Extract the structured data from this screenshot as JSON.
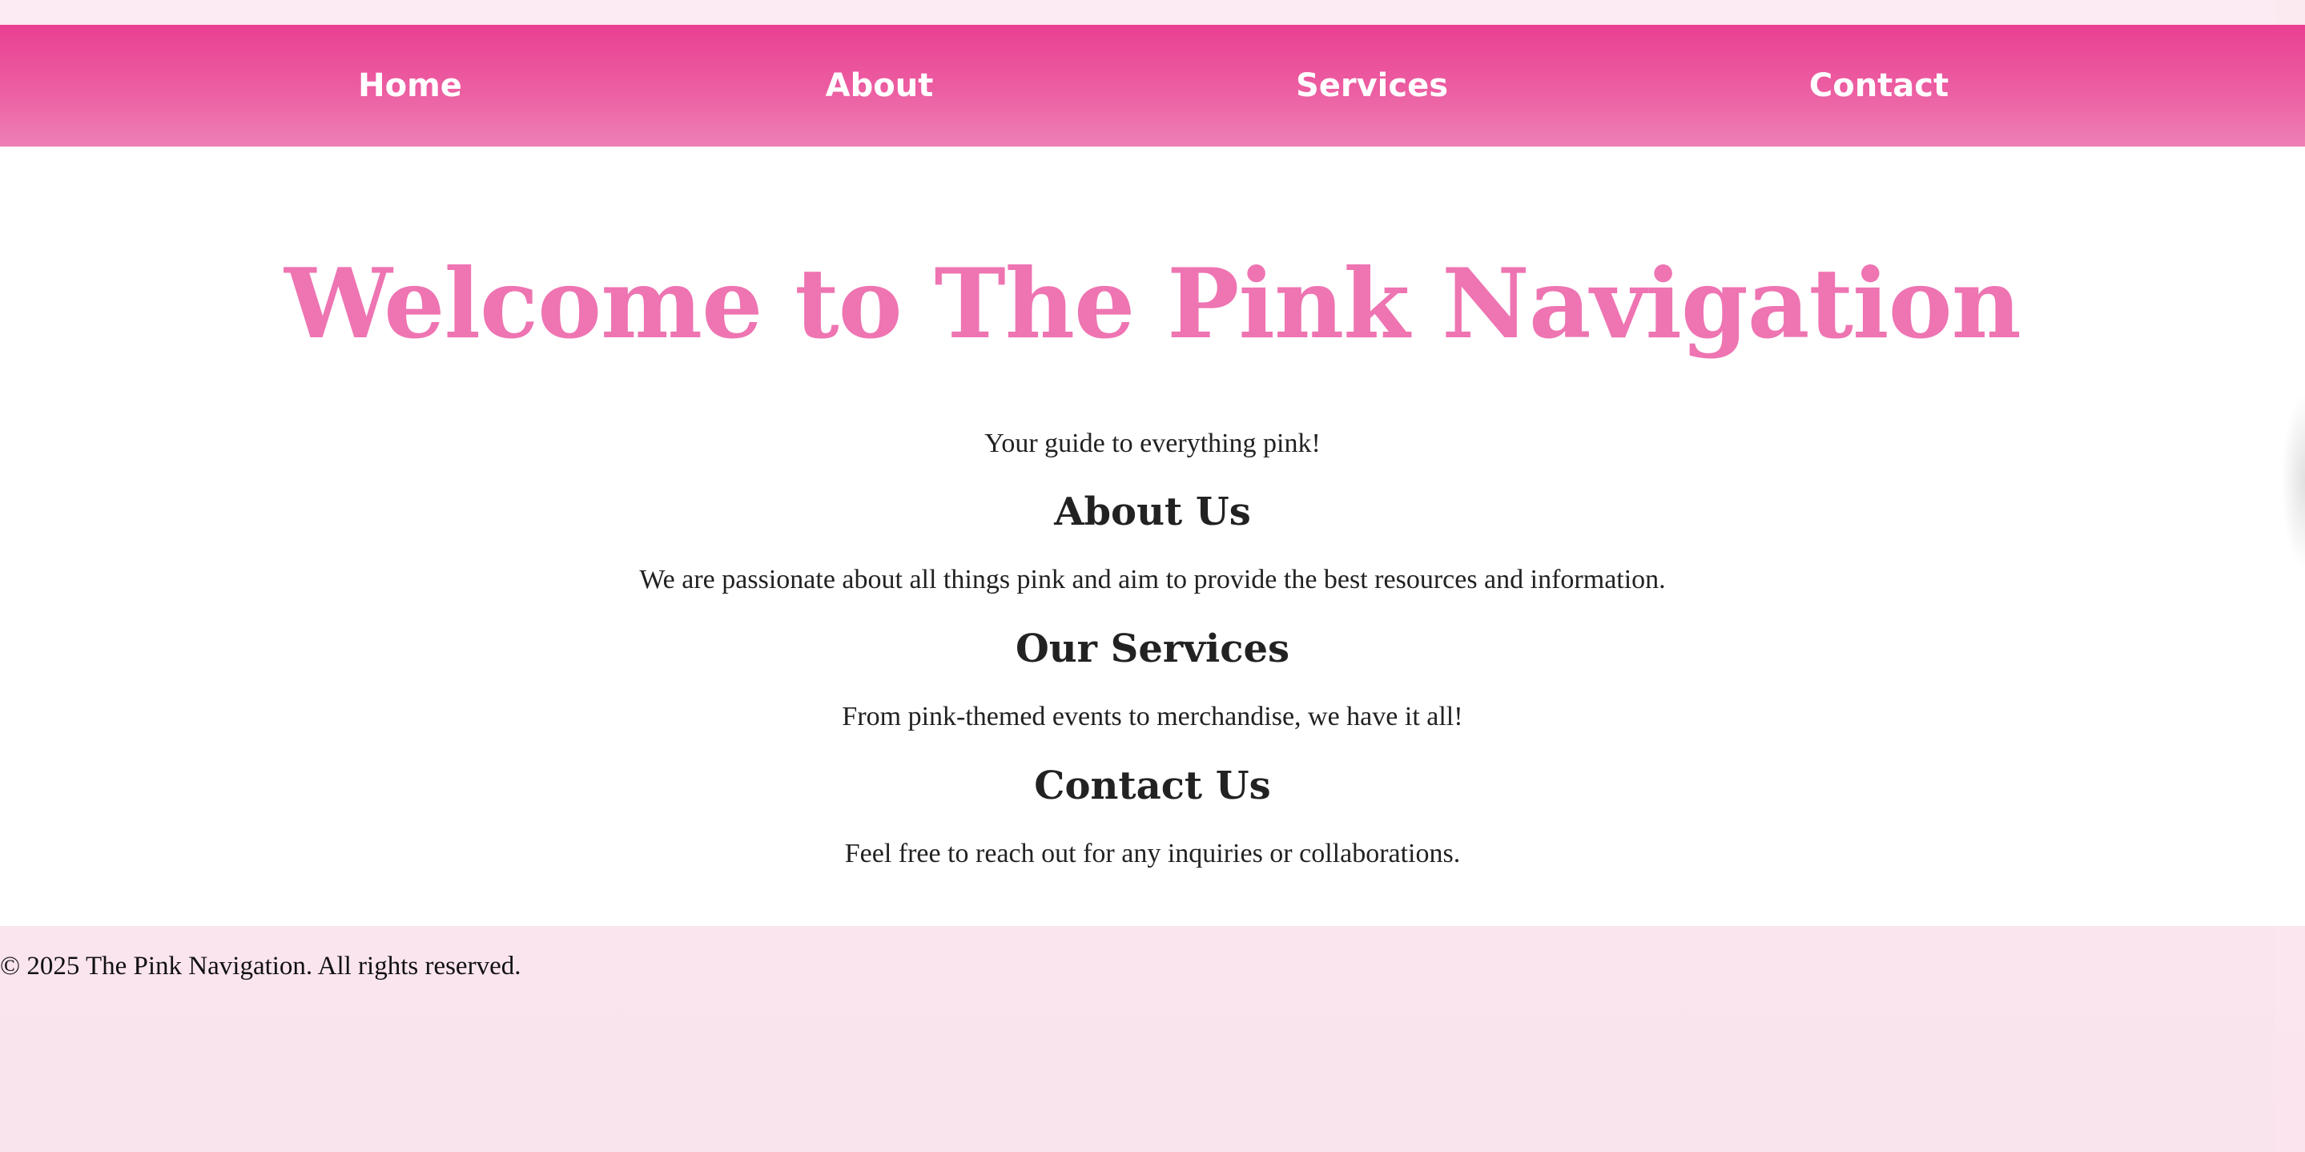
{
  "nav": {
    "items": [
      {
        "label": "Home"
      },
      {
        "label": "About"
      },
      {
        "label": "Services"
      },
      {
        "label": "Contact"
      }
    ]
  },
  "hero": {
    "title": "Welcome to The Pink Navigation",
    "tagline": "Your guide to everything pink!"
  },
  "sections": {
    "about": {
      "heading": "About Us",
      "text": "We are passionate about all things pink and aim to provide the best resources and information."
    },
    "services": {
      "heading": "Our Services",
      "text": "From pink-themed events to merchandise, we have it all!"
    },
    "contact": {
      "heading": "Contact Us",
      "text": "Feel free to reach out for any inquiries or collaborations."
    }
  },
  "footer": {
    "text": "© 2025 The Pink Navigation. All rights reserved."
  },
  "colors": {
    "nav_top": "#ea3f93",
    "nav_bottom": "#ee80b6",
    "title": "#ee74b2",
    "page_background": "#fcebf2"
  }
}
